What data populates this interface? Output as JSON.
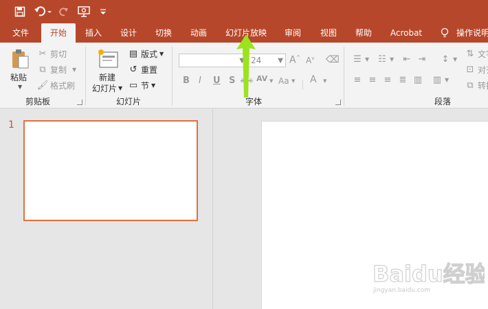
{
  "tabs": [
    {
      "label": "文件",
      "active": false
    },
    {
      "label": "开始",
      "active": true
    },
    {
      "label": "插入",
      "active": false
    },
    {
      "label": "设计",
      "active": false
    },
    {
      "label": "切换",
      "active": false
    },
    {
      "label": "动画",
      "active": false
    },
    {
      "label": "幻灯片放映",
      "active": false
    },
    {
      "label": "审阅",
      "active": false
    },
    {
      "label": "视图",
      "active": false
    },
    {
      "label": "帮助",
      "active": false
    },
    {
      "label": "Acrobat",
      "active": false
    },
    {
      "label": "操作说明",
      "active": false
    }
  ],
  "clipboard": {
    "paste": "粘贴",
    "cut": "剪切",
    "copy": "复制",
    "format_painter": "格式刷",
    "group_label": "剪贴板"
  },
  "slides": {
    "new_slide_line1": "新建",
    "new_slide_line2": "幻灯片",
    "layout": "版式",
    "reset": "重置",
    "section": "节",
    "group_label": "幻灯片"
  },
  "font": {
    "font_name": "",
    "font_size": "24",
    "group_label": "字体"
  },
  "paragraph": {
    "text_direction": "文字",
    "align_text": "对齐",
    "convert": "转换",
    "group_label": "段落"
  },
  "thumbnail_pane": {
    "slide_number": "1"
  },
  "watermark": {
    "brand": "Baidu经验",
    "url": "jingyan.baidu.com"
  },
  "colors": {
    "accent": "#b7472a",
    "thumb_border": "#e0703f",
    "annotation_arrow": "#9be31c"
  }
}
